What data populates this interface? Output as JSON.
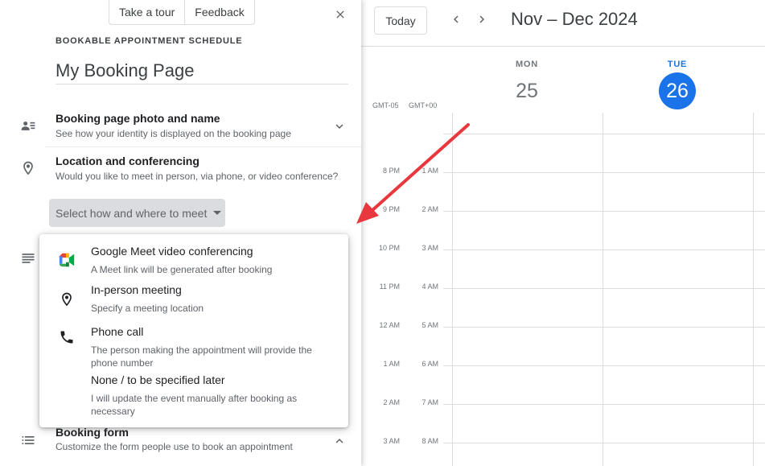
{
  "calendar": {
    "today_label": "Today",
    "date_range": "Nov – Dec 2024",
    "days": [
      {
        "name": "MON",
        "number": "25"
      },
      {
        "name": "TUE",
        "number": "26"
      }
    ],
    "tz_primary": "GMT-05",
    "tz_secondary": "GMT+00",
    "times_primary": [
      "8 PM",
      "9 PM",
      "10 PM",
      "11 PM",
      "12 AM",
      "1 AM",
      "2 AM",
      "3 AM"
    ],
    "times_secondary": [
      "1 AM",
      "2 AM",
      "3 AM",
      "4 AM",
      "5 AM",
      "6 AM",
      "7 AM",
      "8 AM"
    ]
  },
  "panel": {
    "take_tour_label": "Take a tour",
    "feedback_label": "Feedback",
    "kicker": "BOOKABLE APPOINTMENT SCHEDULE",
    "title": "My Booking Page",
    "sections": {
      "photo": {
        "title": "Booking page photo and name",
        "subtitle": "See how your identity is displayed on the booking page"
      },
      "location": {
        "title": "Location and conferencing",
        "subtitle": "Would you like to meet in person, via phone, or video conference?"
      },
      "booking_form": {
        "title": "Booking form",
        "subtitle": "Customize the form people use to book an appointment"
      }
    },
    "select_label": "Select how and where to meet"
  },
  "menu": {
    "items": [
      {
        "icon": "google-meet-icon",
        "title": "Google Meet video conferencing",
        "subtitle": "A Meet link will be generated after booking"
      },
      {
        "icon": "location-pin-icon",
        "title": "In-person meeting",
        "subtitle": "Specify a meeting location"
      },
      {
        "icon": "phone-icon",
        "title": "Phone call",
        "subtitle": "The person making the appointment will provide the phone number"
      },
      {
        "icon": "",
        "title": "None / to be specified later",
        "subtitle": "I will update the event manually after booking as necessary"
      }
    ]
  },
  "colors": {
    "accent": "#1a73e8",
    "annotation_arrow": "#e8383d"
  }
}
